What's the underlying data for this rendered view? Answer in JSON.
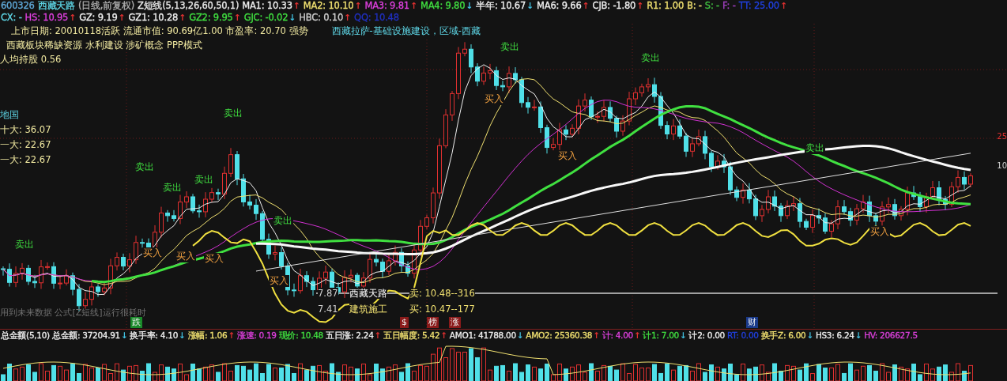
{
  "header_row_1": [
    {
      "text": "600326",
      "color": "#5fa8d8"
    },
    {
      "text": "西藏天路",
      "color": "#5fd8e8"
    },
    {
      "text": "(日线,前复权)",
      "color": "#b0b0b0"
    },
    {
      "text": "Z短线(5,13,26,60,50,1)",
      "color": "#e8e8e8"
    },
    {
      "text": "MA1: 10.33",
      "color": "#f0f0f0",
      "arrow": "↑"
    },
    {
      "text": "MA2: 10.10",
      "color": "#f0e070",
      "arrow": "↑"
    },
    {
      "text": "MA3: 9.81",
      "color": "#e040e0",
      "arrow": "↑"
    },
    {
      "text": "MA4: 9.80",
      "color": "#40e040",
      "arrow": "↓"
    },
    {
      "text": "半年: 10.67",
      "color": "#f0f0f0",
      "arrow": "↓"
    },
    {
      "text": "MA6: 9.66",
      "color": "#f0f0f0",
      "arrow": "↑"
    },
    {
      "text": "CJB: -1.80",
      "color": "#f0f0f0",
      "arrow": "↑"
    },
    {
      "text": "R1: 1.00",
      "color": "#f0e070"
    },
    {
      "text": "B: -",
      "color": "#f0e070"
    },
    {
      "text": "S: -",
      "color": "#40c040"
    },
    {
      "text": "F: -",
      "color": "#a040c0"
    },
    {
      "text": "TT: 25.00",
      "color": "#2040e0",
      "arrow": "↑"
    }
  ],
  "header_row_2": [
    {
      "text": "CX: -",
      "color": "#5fd8e8"
    },
    {
      "text": "HS: 10.95",
      "color": "#e040e0",
      "arrow": "↑"
    },
    {
      "text": "GZ: 9.19",
      "color": "#f0f0f0",
      "arrow": "↑"
    },
    {
      "text": "GZ1: 10.28",
      "color": "#f0f0f0",
      "arrow": "↑"
    },
    {
      "text": "GZ2: 9.95",
      "color": "#40e040",
      "arrow": "↑"
    },
    {
      "text": "GJC: -0.02",
      "color": "#40e040",
      "arrow": "↓"
    },
    {
      "text": "HBC: 0.10",
      "color": "#d0d0d0",
      "arrow": "↑"
    },
    {
      "text": "QQ: 10.48",
      "color": "#2030c0"
    }
  ],
  "info": {
    "listing": "上市日期: 20010118活跃 流通市值: 90.69亿1.00 市盈率: 20.70  强势",
    "region": "西藏拉萨-基础设施建设，区域-西藏",
    "concepts": "西藏板块稀缺资源 水利建设 涉矿概念 PPP模式",
    "per_capita": "人均持股  0.56",
    "holder_title": "地国",
    "holders": [
      "十大: 36.07",
      "一大: 22.67",
      "一大: 22.67"
    ]
  },
  "axis_labels": [
    {
      "text": "25",
      "color": "#e03030"
    },
    {
      "text": "10",
      "color": "#d0d0d0"
    }
  ],
  "signals": [
    {
      "kind": "sell",
      "text": "卖出"
    },
    {
      "kind": "sell",
      "text": "卖出"
    },
    {
      "kind": "sell",
      "text": "卖出"
    },
    {
      "kind": "sell",
      "text": "卖出"
    },
    {
      "kind": "sell",
      "text": "卖出"
    },
    {
      "kind": "sell",
      "text": "卖出"
    },
    {
      "kind": "sell",
      "text": "卖出"
    },
    {
      "kind": "sell",
      "text": "卖出"
    },
    {
      "kind": "sell",
      "text": "卖出"
    },
    {
      "kind": "buy",
      "text": "买入"
    },
    {
      "kind": "buy",
      "text": "买入"
    },
    {
      "kind": "buy",
      "text": "买入"
    },
    {
      "kind": "buy",
      "text": "买入"
    },
    {
      "kind": "buy",
      "text": "买入"
    },
    {
      "kind": "buy",
      "text": "买入"
    },
    {
      "kind": "buy",
      "text": "买入"
    }
  ],
  "quotes": [
    {
      "price": "7.87",
      "name": "西藏天路",
      "quote": "卖: 10.48--316"
    },
    {
      "price": "7.41",
      "name": "建筑施工",
      "quote": "买: 10.47--177"
    }
  ],
  "warning": "用到未来数据 公式[Z短线]运行很耗时",
  "event_marks": [
    {
      "text": "跌",
      "color": "#1a8a2a"
    },
    {
      "text": "$",
      "color": "#8a1a1a"
    },
    {
      "text": "榜",
      "color": "#8a1a1a"
    },
    {
      "text": "涨",
      "color": "#8a1a1a"
    },
    {
      "text": "财",
      "color": "#1a3a8a"
    }
  ],
  "stats_row": [
    {
      "text": "总金额(5,10)",
      "color": "#f0f0f0"
    },
    {
      "text": "总金额: 37204.91",
      "color": "#f0f0f0",
      "arrow": "↓"
    },
    {
      "text": "换手率: 4.10",
      "color": "#f0f0f0",
      "arrow": "↓"
    },
    {
      "text": "涨幅: 1.06",
      "color": "#f0e070",
      "arrow": "↑"
    },
    {
      "text": "涨速: 0.19",
      "color": "#e040e0"
    },
    {
      "text": "现价: 10.48",
      "color": "#40e040"
    },
    {
      "text": "五日涨: 2.24",
      "color": "#f0f0f0",
      "arrow": "↑"
    },
    {
      "text": "五日幅度: 5.42",
      "color": "#f0e070",
      "arrow": "↑"
    },
    {
      "text": "AMO1: 41788.00",
      "color": "#f0f0f0",
      "arrow": "↓"
    },
    {
      "text": "AMO2: 25360.38",
      "color": "#f0e070",
      "arrow": "↑"
    },
    {
      "text": "计: 4.00",
      "color": "#e040e0",
      "arrow": "↑"
    },
    {
      "text": "计1: 7.00",
      "color": "#40e040",
      "arrow": "↓"
    },
    {
      "text": "计2: 0.00",
      "color": "#f0f0f0"
    },
    {
      "text": "RT: 0.00",
      "color": "#2040e0"
    },
    {
      "text": "换手Z: 6.00",
      "color": "#f0e070",
      "arrow": "↓"
    },
    {
      "text": "HS3: 6.24",
      "color": "#f0f0f0",
      "arrow": "↓"
    },
    {
      "text": "HV: 206627.5",
      "color": "#e040e0"
    }
  ]
}
